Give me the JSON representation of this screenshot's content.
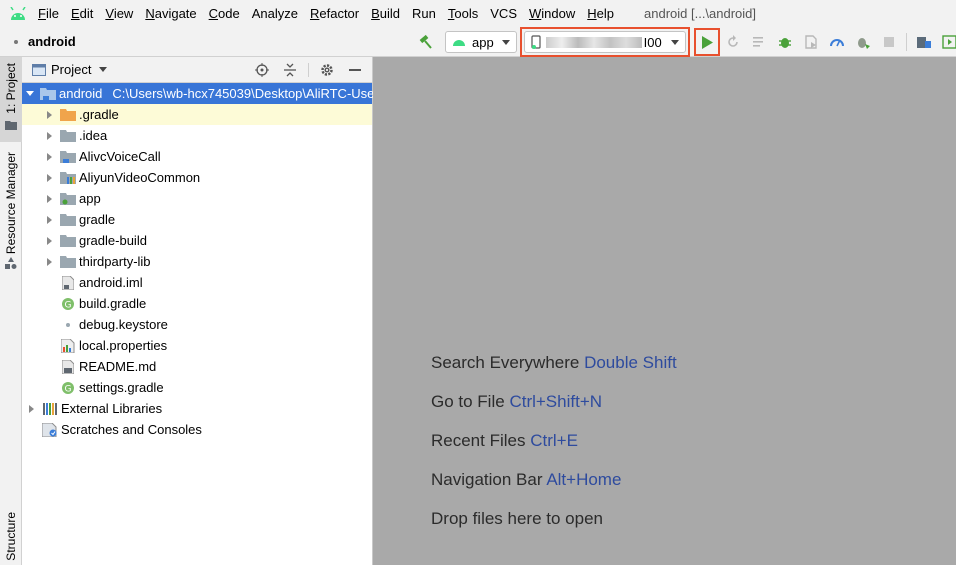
{
  "menu": {
    "items": [
      {
        "mn": "F",
        "rest": "ile"
      },
      {
        "mn": "E",
        "rest": "dit"
      },
      {
        "mn": "V",
        "rest": "iew"
      },
      {
        "mn": "N",
        "rest": "avigate"
      },
      {
        "mn": "C",
        "rest": "ode"
      },
      {
        "mn": "",
        "rest": "Analyze"
      },
      {
        "mn": "R",
        "rest": "efactor"
      },
      {
        "mn": "B",
        "rest": "uild"
      },
      {
        "mn": "",
        "rest": "Run"
      },
      {
        "mn": "T",
        "rest": "ools"
      },
      {
        "mn": "",
        "rest": "VCS"
      },
      {
        "mn": "W",
        "rest": "indow"
      },
      {
        "mn": "H",
        "rest": "elp"
      }
    ],
    "window_title": "android [...\\android]"
  },
  "toolbar": {
    "breadcrumb": "android",
    "run_config": "app",
    "device_suffix": "I00"
  },
  "left_strip": {
    "project_tab": "1: Project",
    "resource_tab": "Resource Manager",
    "structure_tab": "Structure"
  },
  "panel": {
    "title": "Project"
  },
  "tree": {
    "root_name": "android",
    "root_path": "C:\\Users\\wb-hcx745039\\Desktop\\AliRTC-Use",
    "items": [
      {
        "label": ".gradle"
      },
      {
        "label": ".idea"
      },
      {
        "label": "AlivcVoiceCall"
      },
      {
        "label": "AliyunVideoCommon"
      },
      {
        "label": "app"
      },
      {
        "label": "gradle"
      },
      {
        "label": "gradle-build"
      },
      {
        "label": "thirdparty-lib"
      },
      {
        "label": "android.iml"
      },
      {
        "label": "build.gradle"
      },
      {
        "label": "debug.keystore"
      },
      {
        "label": "local.properties"
      },
      {
        "label": "README.md"
      },
      {
        "label": "settings.gradle"
      }
    ],
    "external": "External Libraries",
    "scratches": "Scratches and Consoles"
  },
  "editor": {
    "hints": [
      {
        "text": "Search Everywhere",
        "shortcut": "Double Shift"
      },
      {
        "text": "Go to File",
        "shortcut": "Ctrl+Shift+N"
      },
      {
        "text": "Recent Files",
        "shortcut": "Ctrl+E"
      },
      {
        "text": "Navigation Bar",
        "shortcut": "Alt+Home"
      },
      {
        "text": "Drop files here to open",
        "shortcut": ""
      }
    ]
  },
  "colors": {
    "accent_highlight": "#e8502e",
    "selection_blue": "#3875d7",
    "shortcut_blue": "#2e4b9e",
    "android_green": "#3ddc84"
  }
}
